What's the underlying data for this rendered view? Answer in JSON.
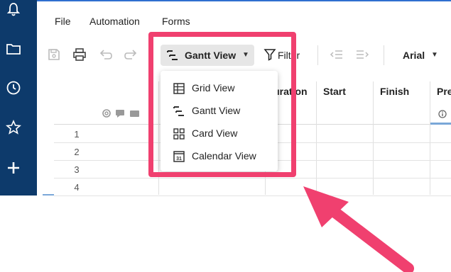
{
  "menu": {
    "file": "File",
    "automation": "Automation",
    "forms": "Forms"
  },
  "toolbar": {
    "view_label": "Gantt View",
    "filter_label": "Filter",
    "font_label": "Arial"
  },
  "grid": {
    "columns": [
      "Duration",
      "Start",
      "Finish",
      "Pre"
    ],
    "rows": [
      "1",
      "2",
      "3",
      "4"
    ]
  },
  "dropdown": {
    "items": [
      "Grid View",
      "Gantt View",
      "Card View",
      "Calendar View"
    ],
    "calendar_icon_text": "31"
  },
  "colors": {
    "sidebar": "#0d3a6b",
    "highlight": "#f0406f",
    "accent": "#2f6fd0"
  }
}
